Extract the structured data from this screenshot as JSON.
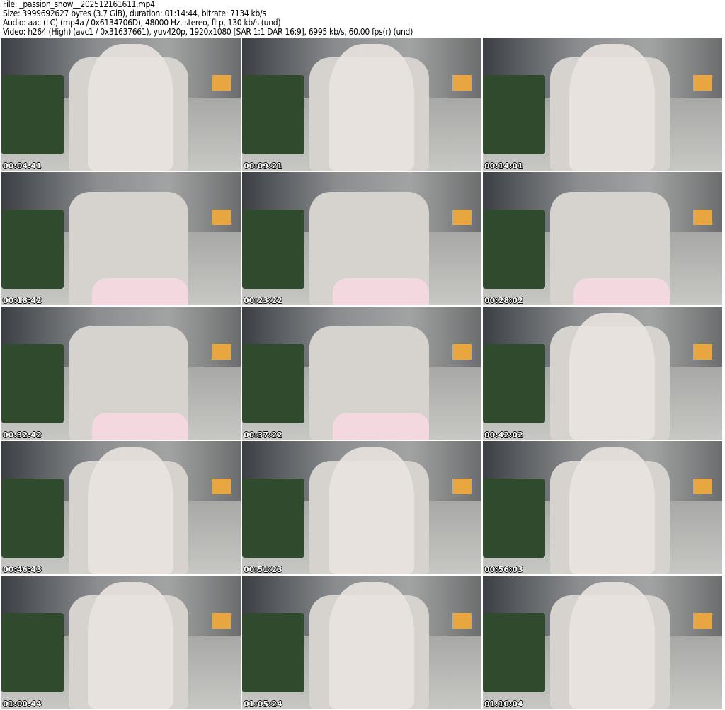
{
  "header": {
    "file": "File: _passion_show__202512161611.mp4",
    "size": "Size: 3999692627 bytes (3.7 GiB), duration: 01:14:44, bitrate: 7134 kb/s",
    "audio": "Audio: aac (LC) (mp4a / 0x6134706D), 48000 Hz, stereo, fltp, 130 kb/s (und)",
    "video": "Video: h264 (High) (avc1 / 0x31637661), yuv420p, 1920x1080 [SAR 1:1 DAR 16:9], 6995 kb/s, 60.00 fps(r) (und)"
  },
  "thumbnails": [
    {
      "timestamp": "00:04:41",
      "scene": "person"
    },
    {
      "timestamp": "00:09:21",
      "scene": "person"
    },
    {
      "timestamp": "00:14:01",
      "scene": "person"
    },
    {
      "timestamp": "00:18:42",
      "scene": "empty-chair"
    },
    {
      "timestamp": "00:23:22",
      "scene": "empty-chair"
    },
    {
      "timestamp": "00:28:02",
      "scene": "empty-chair"
    },
    {
      "timestamp": "00:32:42",
      "scene": "empty-chair"
    },
    {
      "timestamp": "00:37:22",
      "scene": "empty-chair"
    },
    {
      "timestamp": "00:42:02",
      "scene": "person"
    },
    {
      "timestamp": "00:46:43",
      "scene": "person"
    },
    {
      "timestamp": "00:51:23",
      "scene": "person"
    },
    {
      "timestamp": "00:56:03",
      "scene": "person"
    },
    {
      "timestamp": "01:00:44",
      "scene": "person"
    },
    {
      "timestamp": "01:05:24",
      "scene": "person"
    },
    {
      "timestamp": "01:10:04",
      "scene": "person"
    }
  ]
}
